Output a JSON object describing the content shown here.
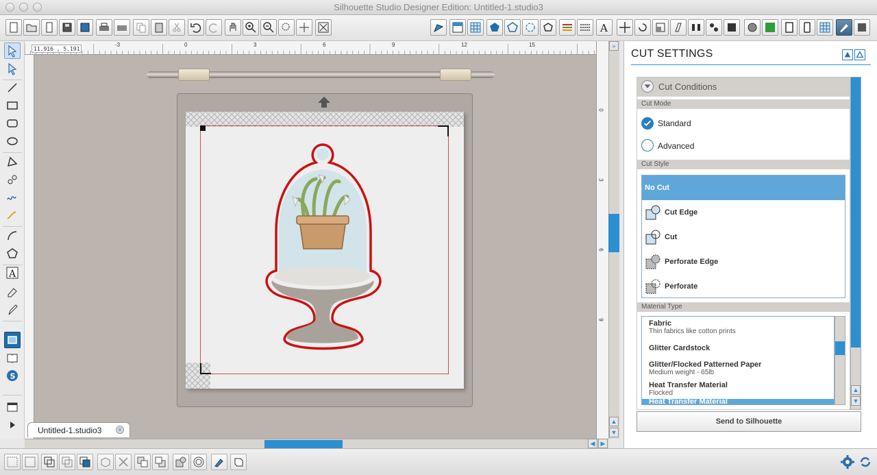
{
  "window": {
    "title": "Silhouette Studio Designer Edition: Untitled-1.studio3"
  },
  "ruler": {
    "coords": "11.916 , 5.191",
    "top_ticks": [
      "-3",
      "0",
      "3",
      "6",
      "9",
      "12",
      "15"
    ],
    "right_ticks": [
      "0",
      "3",
      "6",
      "9"
    ]
  },
  "document": {
    "tab_name": "Untitled-1.studio3",
    "close_symbol": "x"
  },
  "panel": {
    "title": "CUT SETTINGS",
    "section_title": "Cut Conditions",
    "cut_mode_label": "Cut Mode",
    "cut_modes": [
      {
        "label": "Standard",
        "selected": true
      },
      {
        "label": "Advanced",
        "selected": false
      }
    ],
    "cut_style_label": "Cut Style",
    "cut_styles": [
      {
        "label": "No Cut",
        "selected": true
      },
      {
        "label": "Cut Edge",
        "selected": false
      },
      {
        "label": "Cut",
        "selected": false
      },
      {
        "label": "Perforate Edge",
        "selected": false
      },
      {
        "label": "Perforate",
        "selected": false
      }
    ],
    "material_type_label": "Material Type",
    "materials": [
      {
        "name": "Fabric",
        "sub": "Thin fabrics like cotton prints"
      },
      {
        "name": "Glitter Cardstock",
        "sub": ""
      },
      {
        "name": "Glitter/Flocked Patterned Paper",
        "sub": "Medium weight - 65lb"
      },
      {
        "name": "Heat Transfer Material",
        "sub": "Flocked"
      },
      {
        "name": "Heat Transfer Material",
        "sub": ""
      }
    ],
    "send_button": "Send to Silhouette"
  },
  "colors": {
    "accent": "#2b8fd1",
    "cut_line": "#d24a4a",
    "canvas": "#bcb4ae"
  }
}
